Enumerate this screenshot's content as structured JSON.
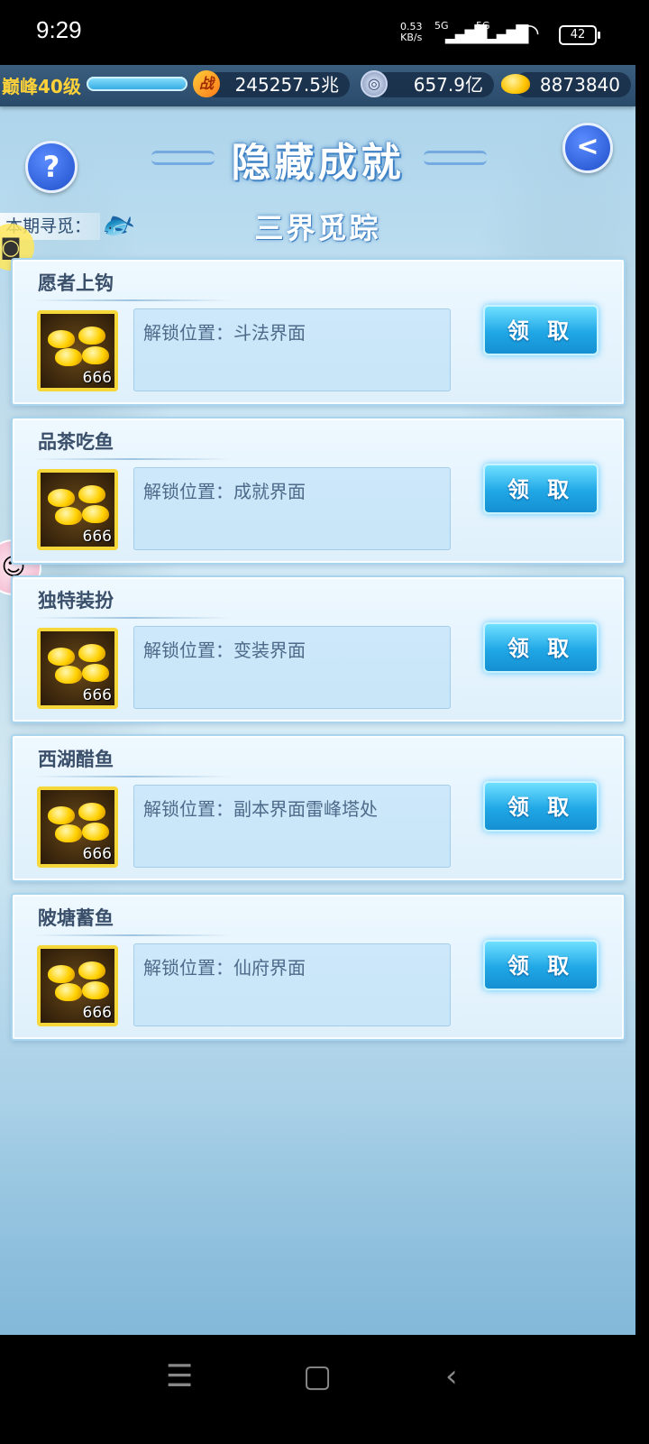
{
  "status_bar": {
    "time": "9:29",
    "net_speed": "0.53",
    "net_unit": "KB/s",
    "signal1_label": "5G",
    "signal2_label": "5G",
    "battery": "42"
  },
  "resources": {
    "level": "巅峰40级",
    "power_icon": "战",
    "power": "245257.5兆",
    "coins": "657.9亿",
    "gold": "8873840"
  },
  "header": {
    "help_label": "?",
    "back_label": "<",
    "title": "隐藏成就",
    "search_label": "本期寻觅：",
    "subtitle": "三界觅踪"
  },
  "achievements": [
    {
      "name": "愿者上钩",
      "reward_count": "666",
      "location": "解锁位置：斗法界面",
      "button": "领 取"
    },
    {
      "name": "品茶吃鱼",
      "reward_count": "666",
      "location": "解锁位置：成就界面",
      "button": "领 取"
    },
    {
      "name": "独特装扮",
      "reward_count": "666",
      "location": "解锁位置：变装界面",
      "button": "领 取"
    },
    {
      "name": "西湖醋鱼",
      "reward_count": "666",
      "location": "解锁位置：副本界面雷峰塔处",
      "button": "领 取"
    },
    {
      "name": "陂塘蓄鱼",
      "reward_count": "666",
      "location": "解锁位置：仙府界面",
      "button": "领 取"
    }
  ],
  "colors": {
    "accent": "#20a7e6",
    "level_text": "#ffd23a",
    "card_bg": "#eef8ff"
  },
  "icons": {
    "help": "question-icon",
    "back": "back-arrow-icon",
    "fish": "fish-icon",
    "reward": "gold-ingot-icon"
  }
}
